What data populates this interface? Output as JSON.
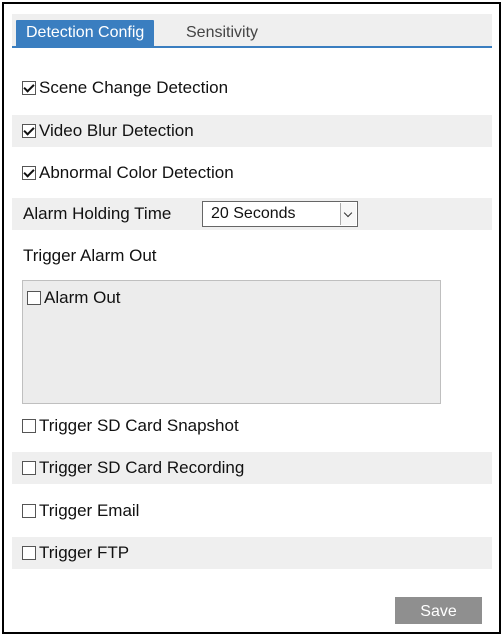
{
  "tabs": [
    {
      "label": "Detection Config",
      "active": true
    },
    {
      "label": "Sensitivity",
      "active": false
    }
  ],
  "detection": {
    "scene_change": {
      "label": "Scene Change Detection",
      "checked": true
    },
    "video_blur": {
      "label": "Video Blur Detection",
      "checked": true
    },
    "abnormal_color": {
      "label": "Abnormal Color Detection",
      "checked": true
    }
  },
  "alarm_holding": {
    "label": "Alarm Holding Time",
    "value": "20 Seconds"
  },
  "trigger_alarm_out": {
    "label": "Trigger Alarm Out",
    "items": [
      {
        "label": "Alarm Out",
        "checked": false
      }
    ]
  },
  "triggers": {
    "sd_snapshot": {
      "label": "Trigger SD Card Snapshot",
      "checked": false
    },
    "sd_recording": {
      "label": "Trigger SD Card Recording",
      "checked": false
    },
    "email": {
      "label": "Trigger Email",
      "checked": false
    },
    "ftp": {
      "label": "Trigger FTP",
      "checked": false
    }
  },
  "actions": {
    "save_label": "Save"
  },
  "colors": {
    "accent": "#3a7ec0",
    "row_shade": "#efefef",
    "save_button": "#8f8f8f"
  }
}
